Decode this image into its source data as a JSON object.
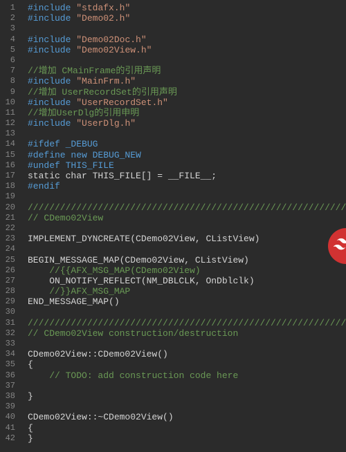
{
  "lines": [
    {
      "n": 1,
      "t": "inc",
      "text": "#include \"stdafx.h\""
    },
    {
      "n": 2,
      "t": "inc",
      "text": "#include \"Demo02.h\""
    },
    {
      "n": 3,
      "t": "blank",
      "text": ""
    },
    {
      "n": 4,
      "t": "inc",
      "text": "#include \"Demo02Doc.h\""
    },
    {
      "n": 5,
      "t": "inc",
      "text": "#include \"Demo02View.h\""
    },
    {
      "n": 6,
      "t": "blank",
      "text": ""
    },
    {
      "n": 7,
      "t": "cmt",
      "text": "//增加 CMainFrame的引用声明"
    },
    {
      "n": 8,
      "t": "inc",
      "text": "#include \"MainFrm.h\""
    },
    {
      "n": 9,
      "t": "cmt",
      "text": "//增加 UserRecordSet的引用声明"
    },
    {
      "n": 10,
      "t": "inc",
      "text": "#include \"UserRecordSet.h\""
    },
    {
      "n": 11,
      "t": "cmt",
      "text": "//增加UserDlg的引用申明"
    },
    {
      "n": 12,
      "t": "inc",
      "text": "#include \"UserDlg.h\""
    },
    {
      "n": 13,
      "t": "blank",
      "text": ""
    },
    {
      "n": 14,
      "t": "pp",
      "text": "#ifdef _DEBUG"
    },
    {
      "n": 15,
      "t": "pp",
      "text": "#define new DEBUG_NEW"
    },
    {
      "n": 16,
      "t": "pp",
      "text": "#undef THIS_FILE"
    },
    {
      "n": 17,
      "t": "code",
      "text": "static char THIS_FILE[] = __FILE__;"
    },
    {
      "n": 18,
      "t": "pp",
      "text": "#endif"
    },
    {
      "n": 19,
      "t": "blank",
      "text": ""
    },
    {
      "n": 20,
      "t": "cmt",
      "text": "/////////////////////////////////////////////////////////////////////////////"
    },
    {
      "n": 21,
      "t": "cmt",
      "text": "// CDemo02View"
    },
    {
      "n": 22,
      "t": "blank",
      "text": ""
    },
    {
      "n": 23,
      "t": "code",
      "text": "IMPLEMENT_DYNCREATE(CDemo02View, CListView)"
    },
    {
      "n": 24,
      "t": "blank",
      "text": ""
    },
    {
      "n": 25,
      "t": "code",
      "text": "BEGIN_MESSAGE_MAP(CDemo02View, CListView)"
    },
    {
      "n": 26,
      "t": "cmt",
      "text": "    //{{AFX_MSG_MAP(CDemo02View)"
    },
    {
      "n": 27,
      "t": "code",
      "text": "    ON_NOTIFY_REFLECT(NM_DBLCLK, OnDblclk)"
    },
    {
      "n": 28,
      "t": "cmt",
      "text": "    //}}AFX_MSG_MAP"
    },
    {
      "n": 29,
      "t": "code",
      "text": "END_MESSAGE_MAP()"
    },
    {
      "n": 30,
      "t": "blank",
      "text": ""
    },
    {
      "n": 31,
      "t": "cmt",
      "text": "/////////////////////////////////////////////////////////////////////////////"
    },
    {
      "n": 32,
      "t": "cmt",
      "text": "// CDemo02View construction/destruction"
    },
    {
      "n": 33,
      "t": "blank",
      "text": ""
    },
    {
      "n": 34,
      "t": "code",
      "text": "CDemo02View::CDemo02View()"
    },
    {
      "n": 35,
      "t": "code",
      "text": "{"
    },
    {
      "n": 36,
      "t": "cmt",
      "text": "    // TODO: add construction code here"
    },
    {
      "n": 37,
      "t": "blank",
      "text": ""
    },
    {
      "n": 38,
      "t": "code",
      "text": "}"
    },
    {
      "n": 39,
      "t": "blank",
      "text": ""
    },
    {
      "n": 40,
      "t": "code",
      "text": "CDemo02View::~CDemo02View()"
    },
    {
      "n": 41,
      "t": "code",
      "text": "{"
    },
    {
      "n": 42,
      "t": "code",
      "text": "}"
    }
  ],
  "watermark": {
    "icon": "logo-icon"
  }
}
